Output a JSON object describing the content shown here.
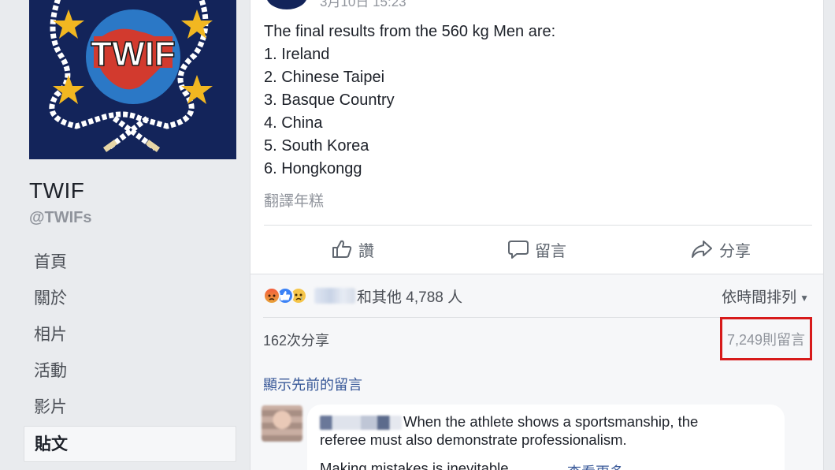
{
  "page": {
    "name": "TWIF",
    "handle": "@TWIFs",
    "logo_text": "TWIF"
  },
  "sidebar": {
    "items": [
      {
        "label": "首頁"
      },
      {
        "label": "關於"
      },
      {
        "label": "相片"
      },
      {
        "label": "活動"
      },
      {
        "label": "影片"
      },
      {
        "label": "貼文",
        "active": true
      }
    ]
  },
  "post": {
    "date": "3月10日 15:23",
    "intro": "The final results from the 560 kg Men are:",
    "results": [
      "1. Ireland",
      "2. Chinese Taipei",
      "3. Basque Country",
      "4. China",
      "5. South Korea",
      "6. Hongkongg"
    ],
    "translate_label": "翻譯年糕"
  },
  "actions": {
    "like": "讚",
    "comment": "留言",
    "share": "分享"
  },
  "feedback": {
    "reactions_text": "和其他 4,788 人",
    "sort_label": "依時間排列",
    "share_count": "162次分享",
    "comment_count": "7,249則留言",
    "show_previous": "顯示先前的留言"
  },
  "comment": {
    "text_line1": "When the athlete shows a sportsmanship, the",
    "text_line2": "referee must also demonstrate professionalism.",
    "text_line3": "Making mistakes is inevitable",
    "see_more": "查看更多"
  },
  "colors": {
    "logo_bg": "#13245a",
    "highlight_border": "#d71a1a",
    "link": "#385898"
  }
}
